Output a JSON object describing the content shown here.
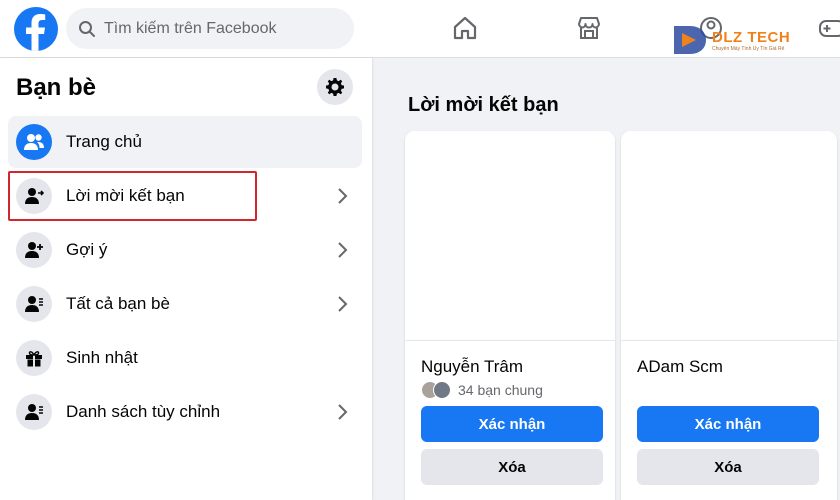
{
  "header": {
    "search_placeholder": "Tìm kiếm trên Facebook",
    "watermark_text": "DLZ TECH",
    "watermark_subtext": "Chuyên Máy Tính Uy Tín Giá Rẻ"
  },
  "sidebar": {
    "title": "Bạn bè",
    "items": [
      {
        "label": "Trang chủ",
        "icon": "friends-icon",
        "active": true
      },
      {
        "label": "Lời mời kết bạn",
        "icon": "friend-request-icon",
        "chevron": true
      },
      {
        "label": "Gợi ý",
        "icon": "add-friend-icon",
        "chevron": true
      },
      {
        "label": "Tất cả bạn bè",
        "icon": "friend-list-icon",
        "chevron": true
      },
      {
        "label": "Sinh nhật",
        "icon": "gift-icon"
      },
      {
        "label": "Danh sách tùy chỉnh",
        "icon": "custom-list-icon",
        "chevron": true
      }
    ]
  },
  "main": {
    "title": "Lời mời kết bạn",
    "cards": [
      {
        "name": "Nguyễn Trâm",
        "mutual": "34 bạn chung",
        "confirm_label": "Xác nhận",
        "delete_label": "Xóa"
      },
      {
        "name": "ADam Scm",
        "confirm_label": "Xác nhận",
        "delete_label": "Xóa"
      }
    ]
  },
  "colors": {
    "primary": "#1877f2",
    "highlight": "#d0272f",
    "watermark": "#f0821e"
  }
}
